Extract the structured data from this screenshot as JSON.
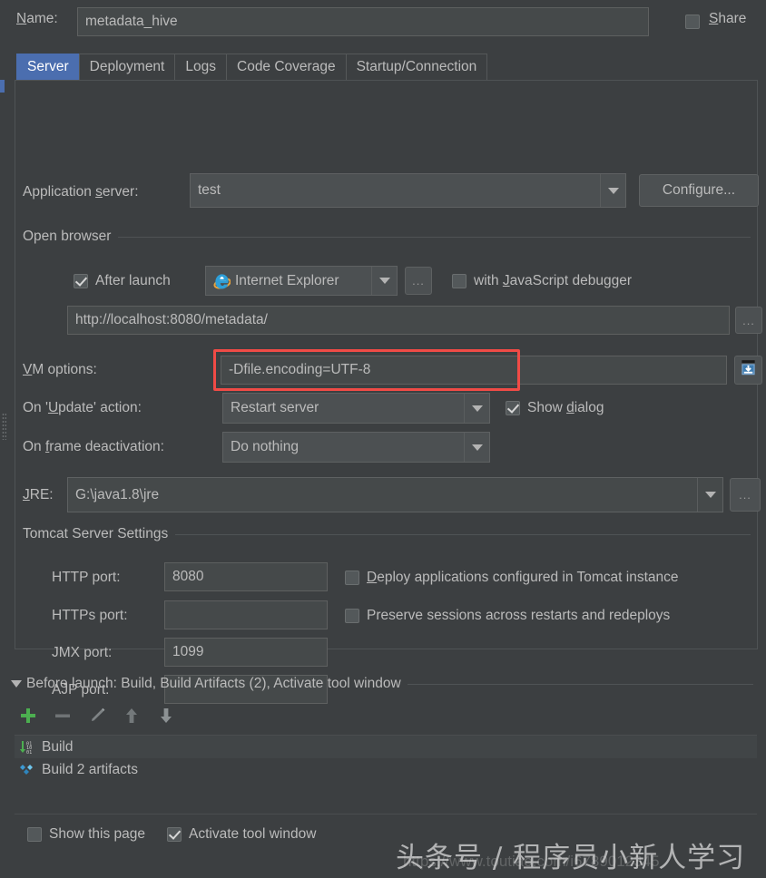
{
  "window": {
    "theme_bg": "#3c3f41",
    "accent": "#4b6eaf",
    "highlight_color": "#f04b46"
  },
  "name_row": {
    "label": "Name:",
    "label_mnemonic": "N",
    "value": "metadata_hive",
    "placeholder": "Name",
    "share_label": "Share",
    "share_mnemonic": "S",
    "share_checked": false
  },
  "tabs": [
    {
      "label": "Server",
      "active": true
    },
    {
      "label": "Deployment",
      "active": false
    },
    {
      "label": "Logs",
      "active": false
    },
    {
      "label": "Code Coverage",
      "active": false
    },
    {
      "label": "Startup/Connection",
      "active": false
    }
  ],
  "server": {
    "app_server": {
      "label": "Application server:",
      "value": "test",
      "configure_button": "Configure..."
    },
    "open_browser": {
      "group_title": "Open browser",
      "after_launch_label": "After launch",
      "after_launch_checked": true,
      "browser_value": "Internet Explorer",
      "browser_icon": "internet-explorer-icon",
      "browser_ellipsis": "...",
      "js_debugger_label": "with JavaScript debugger",
      "js_debugger_checked": false,
      "url_value": "http://localhost:8080/metadata/",
      "url_ellipsis": "..."
    },
    "vm_options": {
      "label": "VM options:",
      "value": "-Dfile.encoding=UTF-8",
      "expand_icon": "expand-editor-icon",
      "highlighted": true
    },
    "on_update_action": {
      "label": "On 'Update' action:",
      "value": "Restart server",
      "show_dialog_label": "Show dialog",
      "show_dialog_checked": true
    },
    "on_frame_deactivation": {
      "label": "On frame deactivation:",
      "value": "Do nothing"
    },
    "jre": {
      "label": "JRE:",
      "value": "G:\\java1.8\\jre",
      "ellipsis": "..."
    },
    "tomcat_settings": {
      "group_title": "Tomcat Server Settings",
      "ports": [
        {
          "label": "HTTP port:",
          "value": "8080"
        },
        {
          "label": "HTTPs port:",
          "value": ""
        },
        {
          "label": "JMX port:",
          "value": "1099"
        },
        {
          "label": "AJP port:",
          "value": ""
        }
      ],
      "deploy_label": "Deploy applications configured in Tomcat instance",
      "deploy_checked": false,
      "preserve_label": "Preserve sessions across restarts and redeploys",
      "preserve_checked": false
    }
  },
  "before_launch": {
    "header": "Before launch: Build, Build Artifacts (2), Activate tool window",
    "toolbar": [
      {
        "name": "add-button",
        "glyph": "+"
      },
      {
        "name": "remove-button",
        "glyph": "−"
      },
      {
        "name": "edit-button",
        "glyph": "✎"
      },
      {
        "name": "move-up-button",
        "glyph": "↑"
      },
      {
        "name": "move-down-button",
        "glyph": "↓"
      }
    ],
    "items": [
      {
        "label": "Build",
        "icon": "build-icon"
      },
      {
        "label": "Build 2 artifacts",
        "icon": "artifacts-icon"
      }
    ],
    "show_page_label": "Show this page",
    "show_page_checked": false,
    "activate_tool_window_label": "Activate tool window",
    "activate_tool_window_checked": true
  },
  "watermark": {
    "text": "头条号 / 程序员小新人学习",
    "url": "https://www.toutiao.com/i6789012345"
  }
}
